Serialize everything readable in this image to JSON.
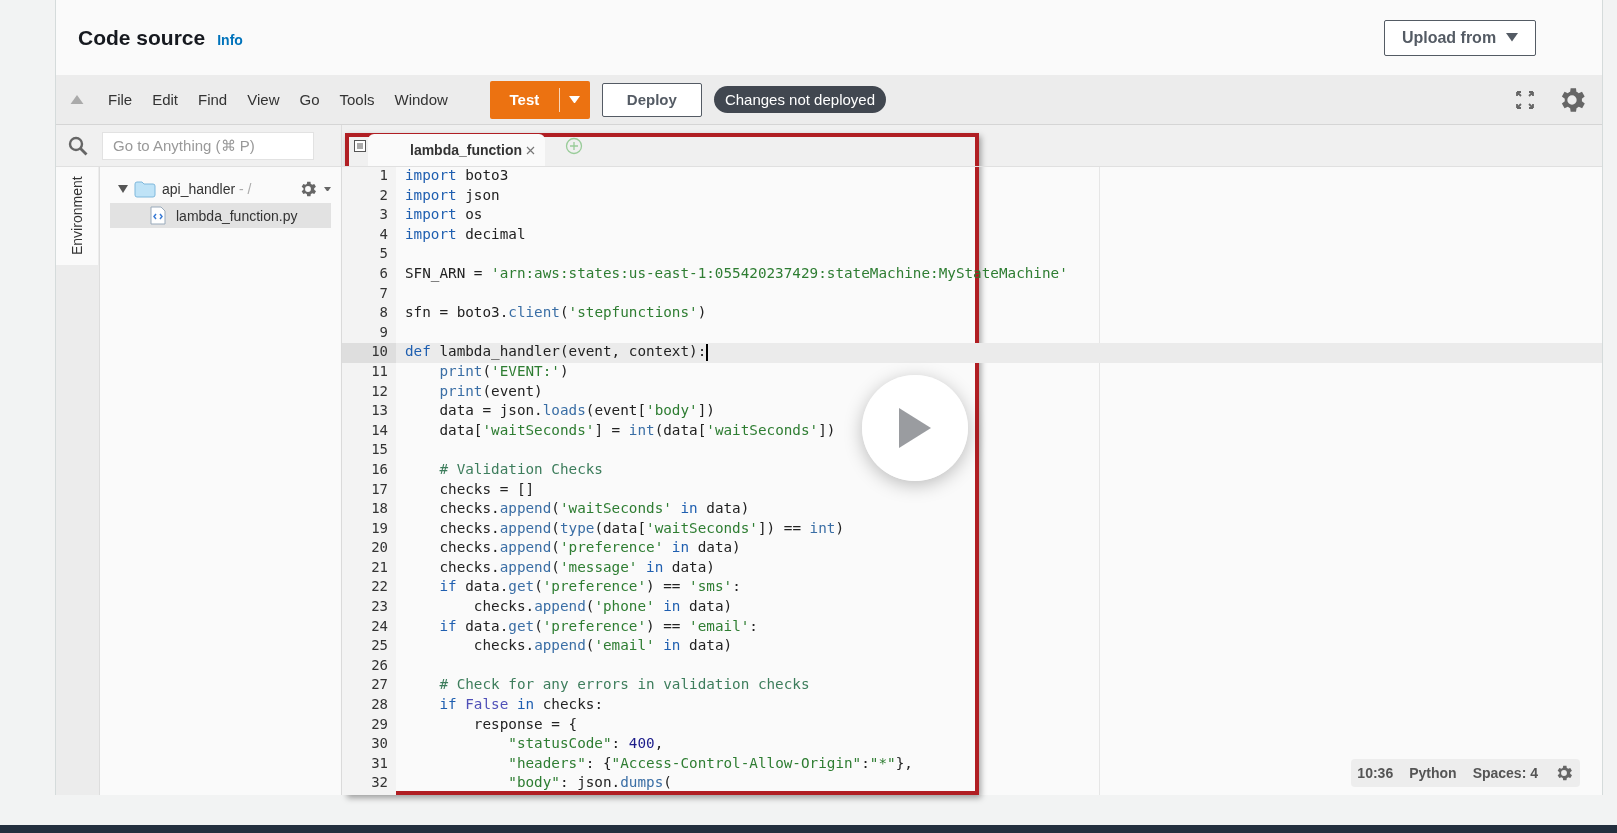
{
  "header": {
    "title": "Code source",
    "info_link": "Info",
    "upload_button": "Upload from"
  },
  "toolbar": {
    "menu": [
      "File",
      "Edit",
      "Find",
      "View",
      "Go",
      "Tools",
      "Window"
    ],
    "test_button": "Test",
    "deploy_button": "Deploy",
    "status_badge": "Changes not deployed"
  },
  "sidebar": {
    "tab_label": "Environment",
    "search": {
      "placeholder": "Go to Anything (⌘ P)"
    },
    "tree": [
      {
        "name": "api_handler",
        "suffix": "- /",
        "expanded": true,
        "children": [
          {
            "name": "lambda_function.py",
            "selected": true
          }
        ]
      }
    ]
  },
  "editor": {
    "tabs": [
      {
        "label": "lambda_function",
        "selected": true
      }
    ],
    "lines": [
      {
        "number": "1",
        "active": false,
        "tokens": [
          {
            "kind": "kw",
            "text": "import"
          },
          {
            "kind": "p",
            "text": " boto3"
          }
        ]
      },
      {
        "number": "2",
        "active": false,
        "tokens": [
          {
            "kind": "kw",
            "text": "import"
          },
          {
            "kind": "p",
            "text": " json"
          }
        ]
      },
      {
        "number": "3",
        "active": false,
        "tokens": [
          {
            "kind": "kw",
            "text": "import"
          },
          {
            "kind": "p",
            "text": " os"
          }
        ]
      },
      {
        "number": "4",
        "active": false,
        "tokens": [
          {
            "kind": "kw",
            "text": "import"
          },
          {
            "kind": "p",
            "text": " decimal"
          }
        ]
      },
      {
        "number": "5",
        "active": false
      },
      {
        "number": "6",
        "active": false,
        "tokens": [
          {
            "kind": "p",
            "text": "SFN_ARN = "
          },
          {
            "kind": "s",
            "text": "'arn:aws:states:us-east-1:055420237429:stateMachine:MyStateMachine'"
          }
        ]
      },
      {
        "number": "7",
        "active": false
      },
      {
        "number": "8",
        "active": false,
        "tokens": [
          {
            "kind": "p",
            "text": "sfn = boto3."
          },
          {
            "kind": "fn",
            "text": "client"
          },
          {
            "kind": "p",
            "text": "("
          },
          {
            "kind": "s",
            "text": "'stepfunctions'"
          },
          {
            "kind": "p",
            "text": ")"
          }
        ]
      },
      {
        "number": "9",
        "active": false
      },
      {
        "number": "10",
        "active": true,
        "tokens": [
          {
            "kind": "kw",
            "text": "def"
          },
          {
            "kind": "p",
            "text": " lambda_handler(event, context):"
          }
        ]
      },
      {
        "number": "11",
        "active": false,
        "tokens": [
          {
            "kind": "fn",
            "text": "    print"
          },
          {
            "kind": "p",
            "text": "("
          },
          {
            "kind": "s",
            "text": "'EVENT:'"
          },
          {
            "kind": "p",
            "text": ")"
          }
        ]
      },
      {
        "number": "12",
        "active": false,
        "tokens": [
          {
            "kind": "fn",
            "text": "    print"
          },
          {
            "kind": "p",
            "text": "(event)"
          }
        ]
      },
      {
        "number": "13",
        "active": false,
        "tokens": [
          {
            "kind": "p",
            "text": "    data = json."
          },
          {
            "kind": "fn",
            "text": "loads"
          },
          {
            "kind": "p",
            "text": "(event["
          },
          {
            "kind": "s",
            "text": "'body'"
          },
          {
            "kind": "p",
            "text": "])"
          }
        ]
      },
      {
        "number": "14",
        "active": false,
        "tokens": [
          {
            "kind": "p",
            "text": "    data["
          },
          {
            "kind": "s",
            "text": "'waitSeconds'"
          },
          {
            "kind": "p",
            "text": "] = "
          },
          {
            "kind": "fn",
            "text": "int"
          },
          {
            "kind": "p",
            "text": "(data["
          },
          {
            "kind": "s",
            "text": "'waitSeconds'"
          },
          {
            "kind": "p",
            "text": "])"
          }
        ]
      },
      {
        "number": "15",
        "active": false
      },
      {
        "number": "16",
        "active": false,
        "tokens": [
          {
            "kind": "c",
            "text": "    # Validation Checks"
          }
        ]
      },
      {
        "number": "17",
        "active": false,
        "tokens": [
          {
            "kind": "p",
            "text": "    checks = []"
          }
        ]
      },
      {
        "number": "18",
        "active": false,
        "tokens": [
          {
            "kind": "p",
            "text": "    checks."
          },
          {
            "kind": "fn",
            "text": "append"
          },
          {
            "kind": "p",
            "text": "("
          },
          {
            "kind": "s",
            "text": "'waitSeconds'"
          },
          {
            "kind": "kw",
            "text": " in"
          },
          {
            "kind": "p",
            "text": " data)"
          }
        ]
      },
      {
        "number": "19",
        "active": false,
        "tokens": [
          {
            "kind": "p",
            "text": "    checks."
          },
          {
            "kind": "fn",
            "text": "append"
          },
          {
            "kind": "p",
            "text": "("
          },
          {
            "kind": "fn",
            "text": "type"
          },
          {
            "kind": "p",
            "text": "(data["
          },
          {
            "kind": "s",
            "text": "'waitSeconds'"
          },
          {
            "kind": "p",
            "text": "]) == "
          },
          {
            "kind": "fn",
            "text": "int"
          },
          {
            "kind": "p",
            "text": ")"
          }
        ]
      },
      {
        "number": "20",
        "active": false,
        "tokens": [
          {
            "kind": "p",
            "text": "    checks."
          },
          {
            "kind": "fn",
            "text": "append"
          },
          {
            "kind": "p",
            "text": "("
          },
          {
            "kind": "s",
            "text": "'preference'"
          },
          {
            "kind": "kw",
            "text": " in"
          },
          {
            "kind": "p",
            "text": " data)"
          }
        ]
      },
      {
        "number": "21",
        "active": false,
        "tokens": [
          {
            "kind": "p",
            "text": "    checks."
          },
          {
            "kind": "fn",
            "text": "append"
          },
          {
            "kind": "p",
            "text": "("
          },
          {
            "kind": "s",
            "text": "'message'"
          },
          {
            "kind": "kw",
            "text": " in"
          },
          {
            "kind": "p",
            "text": " data)"
          }
        ]
      },
      {
        "number": "22",
        "active": false,
        "tokens": [
          {
            "kind": "kw",
            "text": "    if"
          },
          {
            "kind": "p",
            "text": " data."
          },
          {
            "kind": "fn",
            "text": "get"
          },
          {
            "kind": "p",
            "text": "("
          },
          {
            "kind": "s",
            "text": "'preference'"
          },
          {
            "kind": "p",
            "text": ") == "
          },
          {
            "kind": "s",
            "text": "'sms'"
          },
          {
            "kind": "p",
            "text": ":"
          }
        ]
      },
      {
        "number": "23",
        "active": false,
        "tokens": [
          {
            "kind": "p",
            "text": "        checks."
          },
          {
            "kind": "fn",
            "text": "append"
          },
          {
            "kind": "p",
            "text": "("
          },
          {
            "kind": "s",
            "text": "'phone'"
          },
          {
            "kind": "kw",
            "text": " in"
          },
          {
            "kind": "p",
            "text": " data)"
          }
        ]
      },
      {
        "number": "24",
        "active": false,
        "tokens": [
          {
            "kind": "kw",
            "text": "    if"
          },
          {
            "kind": "p",
            "text": " data."
          },
          {
            "kind": "fn",
            "text": "get"
          },
          {
            "kind": "p",
            "text": "("
          },
          {
            "kind": "s",
            "text": "'preference'"
          },
          {
            "kind": "p",
            "text": ") == "
          },
          {
            "kind": "s",
            "text": "'email'"
          },
          {
            "kind": "p",
            "text": ":"
          }
        ]
      },
      {
        "number": "25",
        "active": false,
        "tokens": [
          {
            "kind": "p",
            "text": "        checks."
          },
          {
            "kind": "fn",
            "text": "append"
          },
          {
            "kind": "p",
            "text": "("
          },
          {
            "kind": "s",
            "text": "'email'"
          },
          {
            "kind": "kw",
            "text": " in"
          },
          {
            "kind": "p",
            "text": " data)"
          }
        ]
      },
      {
        "number": "26",
        "active": false
      },
      {
        "number": "27",
        "active": false,
        "tokens": [
          {
            "kind": "c",
            "text": "    # Check for any errors in validation checks"
          }
        ]
      },
      {
        "number": "28",
        "active": false,
        "tokens": [
          {
            "kind": "kw",
            "text": "    if"
          },
          {
            "kind": "const",
            "text": " False"
          },
          {
            "kind": "kw",
            "text": " in"
          },
          {
            "kind": "p",
            "text": " checks:"
          }
        ]
      },
      {
        "number": "29",
        "active": false,
        "tokens": [
          {
            "kind": "p",
            "text": "        response = {"
          }
        ]
      },
      {
        "number": "30",
        "active": false,
        "tokens": [
          {
            "kind": "s",
            "text": "            \"statusCode\""
          },
          {
            "kind": "p",
            "text": ": "
          },
          {
            "kind": "n",
            "text": "400"
          },
          {
            "kind": "p",
            "text": ","
          }
        ]
      },
      {
        "number": "31",
        "active": false,
        "tokens": [
          {
            "kind": "s",
            "text": "            \"headers\""
          },
          {
            "kind": "p",
            "text": ": {"
          },
          {
            "kind": "s",
            "text": "\"Access-Control-Allow-Origin\""
          },
          {
            "kind": "p",
            "text": ":"
          },
          {
            "kind": "s",
            "text": "\"*\""
          },
          {
            "kind": "p",
            "text": "},"
          }
        ]
      },
      {
        "number": "32",
        "active": false,
        "tokens": [
          {
            "kind": "s",
            "text": "            \"body\""
          },
          {
            "kind": "p",
            "text": ": json."
          },
          {
            "kind": "fn",
            "text": "dumps"
          },
          {
            "kind": "p",
            "text": "("
          }
        ]
      }
    ]
  },
  "status_bar": {
    "position": "10:36",
    "language": "Python",
    "indent": "Spaces: 4"
  }
}
